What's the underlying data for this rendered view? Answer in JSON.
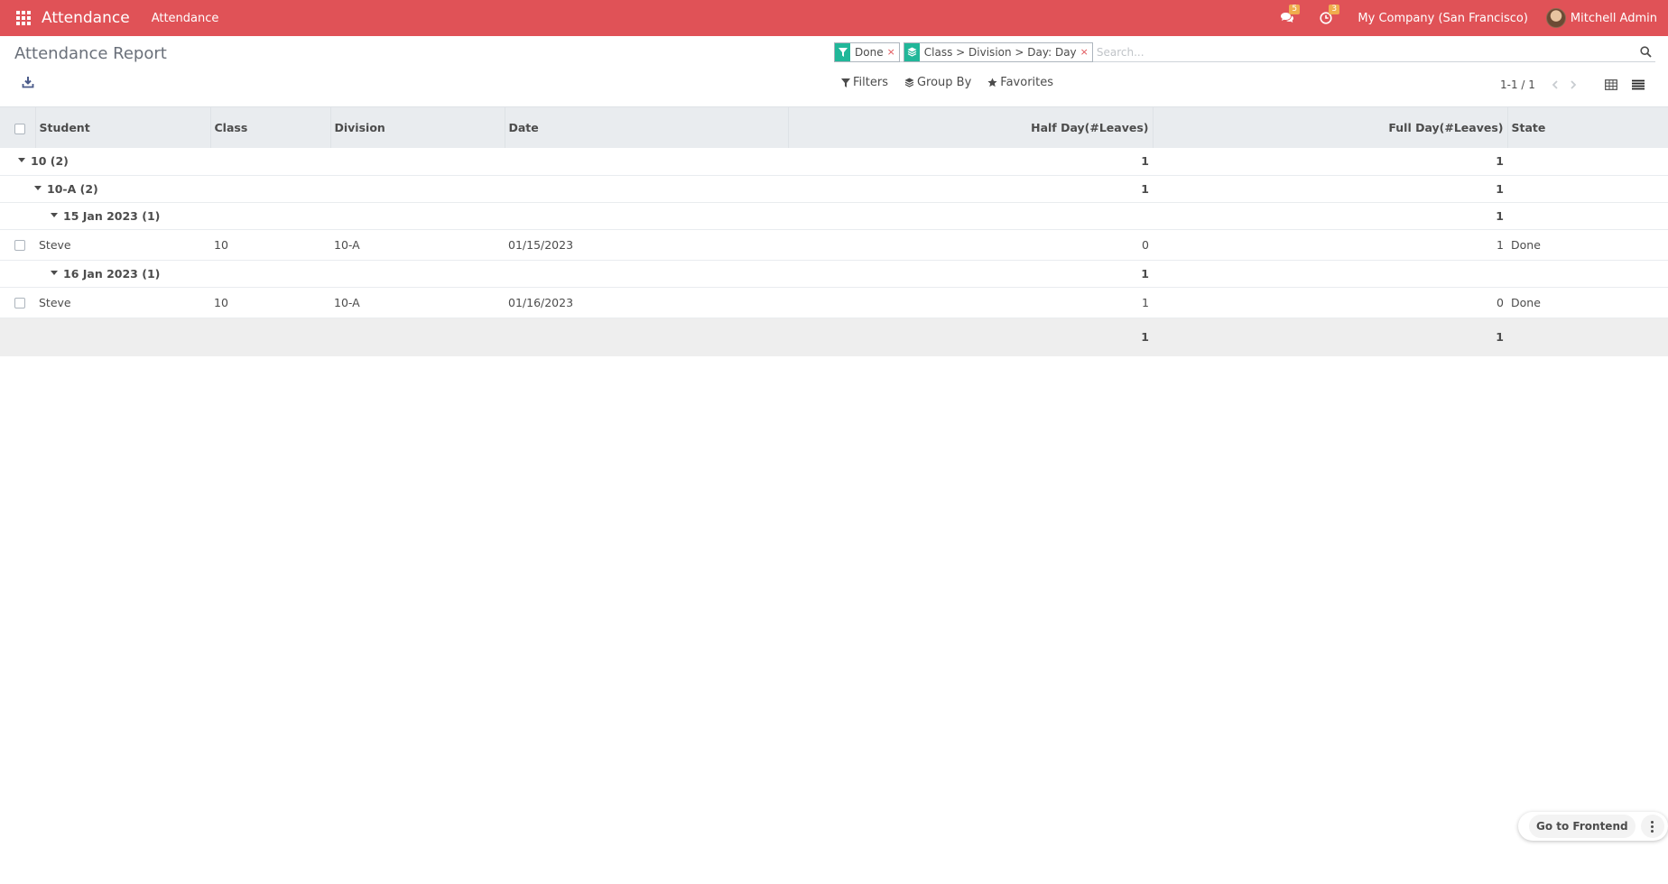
{
  "navbar": {
    "app_name": "Attendance",
    "menu_item": "Attendance",
    "messages_count": "5",
    "activities_count": "3",
    "company": "My Company (San Francisco)",
    "user": "Mitchell Admin"
  },
  "control_panel": {
    "title": "Attendance Report",
    "facets": [
      {
        "value": "Done",
        "remove": "×",
        "icon": "filter-icon"
      },
      {
        "value": "Class > Division > Day: Day",
        "remove": "×",
        "icon": "layers-icon"
      }
    ],
    "search_placeholder": "Search...",
    "filters_label": "Filters",
    "groupby_label": "Group By",
    "favorites_label": "Favorites",
    "pager": "1-1 / 1"
  },
  "table": {
    "headers": [
      "Student",
      "Class",
      "Division",
      "Date",
      "Half Day(#Leaves)",
      "Full Day(#Leaves)",
      "State"
    ],
    "rows": [
      {
        "kind": "group",
        "level": 0,
        "label": "10 (2)",
        "half": "1",
        "full": "1"
      },
      {
        "kind": "group",
        "level": 1,
        "label": "10-A (2)",
        "half": "1",
        "full": "1"
      },
      {
        "kind": "group",
        "level": 2,
        "label": "15 Jan 2023 (1)",
        "half": "",
        "full": "1"
      },
      {
        "kind": "record",
        "student": "Steve",
        "class": "10",
        "division": "10-A",
        "date": "01/15/2023",
        "half": "0",
        "full": "1",
        "state": "Done"
      },
      {
        "kind": "group",
        "level": 2,
        "label": "16 Jan 2023 (1)",
        "half": "1",
        "full": ""
      },
      {
        "kind": "record",
        "student": "Steve",
        "class": "10",
        "division": "10-A",
        "date": "01/16/2023",
        "half": "1",
        "full": "0",
        "state": "Done"
      }
    ],
    "footer": {
      "half": "1",
      "full": "1"
    }
  },
  "floating": {
    "frontend_label": "Go to Frontend"
  },
  "colors": {
    "navbar": "#e05257",
    "facet_icon": "#21b799",
    "badge": "#f0ad4e"
  }
}
